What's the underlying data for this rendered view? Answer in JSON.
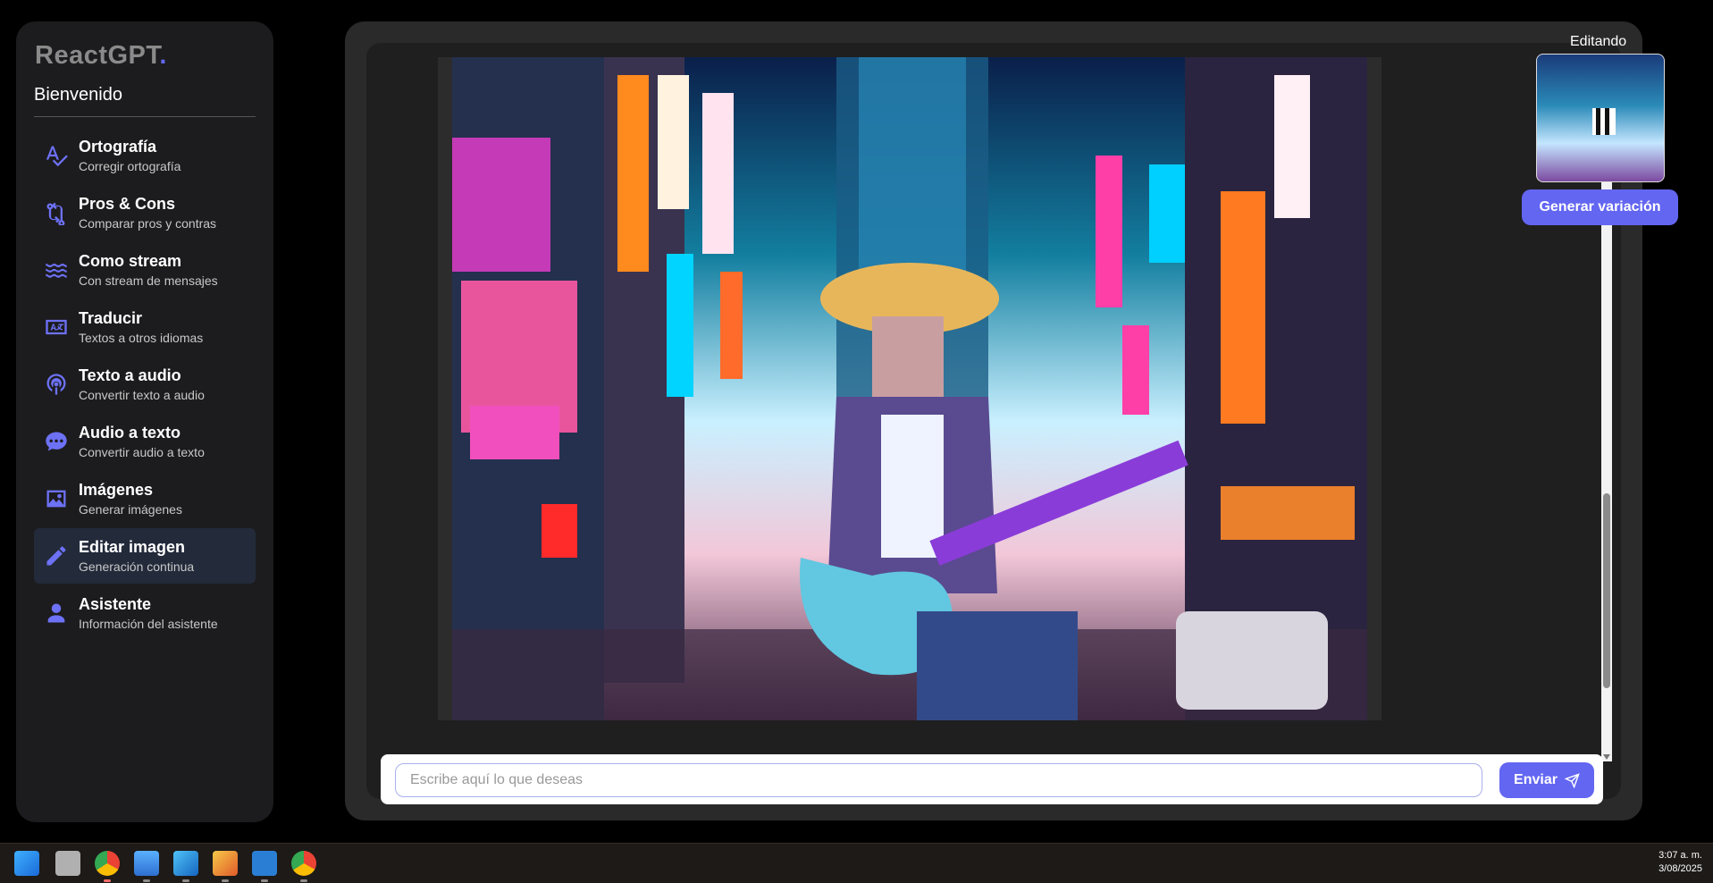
{
  "sidebar": {
    "logo": "ReactGPT",
    "logo_dot": ".",
    "welcome": "Bienvenido",
    "items": [
      {
        "title": "Ortografía",
        "sub": "Corregir ortografía",
        "icon": "spellcheck-icon"
      },
      {
        "title": "Pros & Cons",
        "sub": "Comparar pros y contras",
        "icon": "compare-arrows-icon"
      },
      {
        "title": "Como stream",
        "sub": "Con stream de mensajes",
        "icon": "stream-waves-icon"
      },
      {
        "title": "Traducir",
        "sub": "Textos a otros idiomas",
        "icon": "translate-icon"
      },
      {
        "title": "Texto a audio",
        "sub": "Convertir texto a audio",
        "icon": "podcast-icon"
      },
      {
        "title": "Audio a texto",
        "sub": "Convertir audio a texto",
        "icon": "chat-bubble-icon"
      },
      {
        "title": "Imágenes",
        "sub": "Generar imágenes",
        "icon": "image-icon"
      },
      {
        "title": "Editar imagen",
        "sub": "Generación continua",
        "icon": "pencil-icon",
        "active": true
      },
      {
        "title": "Asistente",
        "sub": "Información del asistente",
        "icon": "user-icon"
      }
    ]
  },
  "editing": {
    "label": "Editando",
    "generate_button": "Generar variación"
  },
  "input": {
    "placeholder": "Escribe aquí lo que deseas",
    "send_label": "Enviar"
  },
  "taskbar": {
    "time": "3:07 a. m.",
    "date": "3/08/2025"
  },
  "colors": {
    "accent": "#6366f1",
    "sidebar_bg": "#1c1c1e",
    "main_bg": "#2a2a2a"
  }
}
